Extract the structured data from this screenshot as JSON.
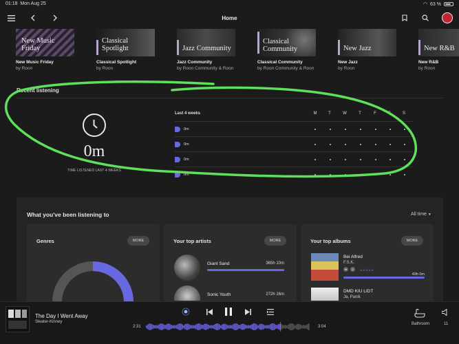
{
  "status_bar": {
    "time": "01:18",
    "date": "Mon Aug 25",
    "battery": "63 %"
  },
  "header": {
    "title": "Home"
  },
  "playlists": [
    {
      "art_title": "New Music Friday",
      "name": "New Music Friday",
      "by": "by Roon"
    },
    {
      "art_title": "Classical Spotlight",
      "name": "Classical Spotlight",
      "by": "by Roon"
    },
    {
      "art_title": "Jazz Community",
      "name": "Jazz Community",
      "by": "by Roon Community & Roon"
    },
    {
      "art_title": "Classical Community",
      "name": "Classical Community",
      "by": "by Roon Community & Roon"
    },
    {
      "art_title": "New Jazz",
      "name": "New Jazz",
      "by": "by Roon"
    },
    {
      "art_title": "New R&B",
      "name": "New R&B",
      "by": "by Roon"
    }
  ],
  "recent": {
    "title": "Recent listening",
    "big_value": "0m",
    "caption": "TIME LISTENED LAST 4 WEEKS",
    "weeks_label": "Last 4 weeks",
    "days": [
      "M",
      "T",
      "W",
      "T",
      "F",
      "S",
      "S"
    ],
    "rows": [
      "0m",
      "0m",
      "0m",
      "0m"
    ]
  },
  "listening": {
    "title": "What you've been listening to",
    "range": "All time",
    "genres": {
      "title": "Genres",
      "more": "MORE",
      "fill_fraction": 0.33,
      "accent": "#6868e0"
    },
    "artists": {
      "title": "Your top artists",
      "more": "MORE",
      "items": [
        {
          "name": "Giant Sand",
          "time": "365h 10m"
        },
        {
          "name": "Sonic Youth",
          "time": "272h 16m"
        }
      ]
    },
    "albums": {
      "title": "Your top albums",
      "more": "MORE",
      "items": [
        {
          "title": "Bei Alfred",
          "artist": "F.S.K.",
          "time": "49h 0m",
          "count": "2"
        },
        {
          "title": "DMD KIU LIDT",
          "artist": "Ja, Panik"
        }
      ]
    }
  },
  "player": {
    "title": "The Day I Went Away",
    "artist": "Sleater-Kinney",
    "elapsed": "2:31",
    "duration": "3:04",
    "zone": "Bathroom",
    "volume": "11",
    "progress_fraction": 0.82
  }
}
